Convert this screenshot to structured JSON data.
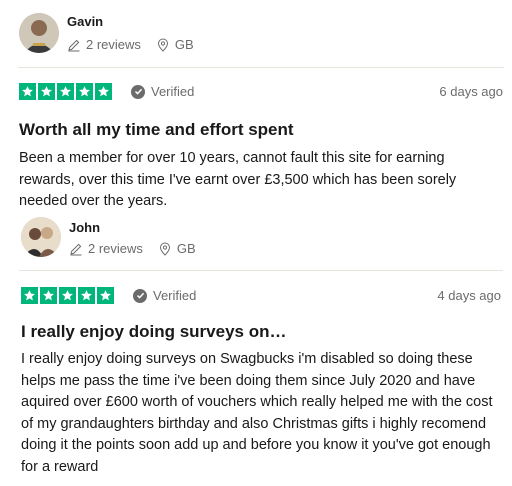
{
  "reviews": [
    {
      "name": "Gavin",
      "reviews_count": "2 reviews",
      "country": "GB",
      "rating": 5,
      "verified_label": "Verified",
      "date": "6 days ago",
      "title": "Worth all my time and effort spent",
      "body": "Been a member for over 10 years, cannot fault this site for earning rewards, over this time I've earnt over £3,500 which has been sorely needed over the years."
    },
    {
      "name": "John",
      "reviews_count": "2 reviews",
      "country": "GB",
      "rating": 5,
      "verified_label": "Verified",
      "date": "4 days ago",
      "title": "I really enjoy doing surveys on…",
      "body": "I really enjoy doing surveys on Swagbucks i'm disabled so doing these helps me pass the time i've been doing them since July 2020 and have aquired over £600 worth of vouchers which really helped me with the cost of my grandaughters birthday and also Christmas gifts i highly recomend doing it the points soon add up and before you know it you've got enough for a reward"
    }
  ],
  "colors": {
    "star_green": "#00b67a",
    "muted": "#6b6b6b",
    "divider": "#e5e5dd"
  },
  "icons": {
    "reviews": "pencil-icon",
    "location": "location-pin-icon",
    "verified": "verified-check-icon"
  }
}
